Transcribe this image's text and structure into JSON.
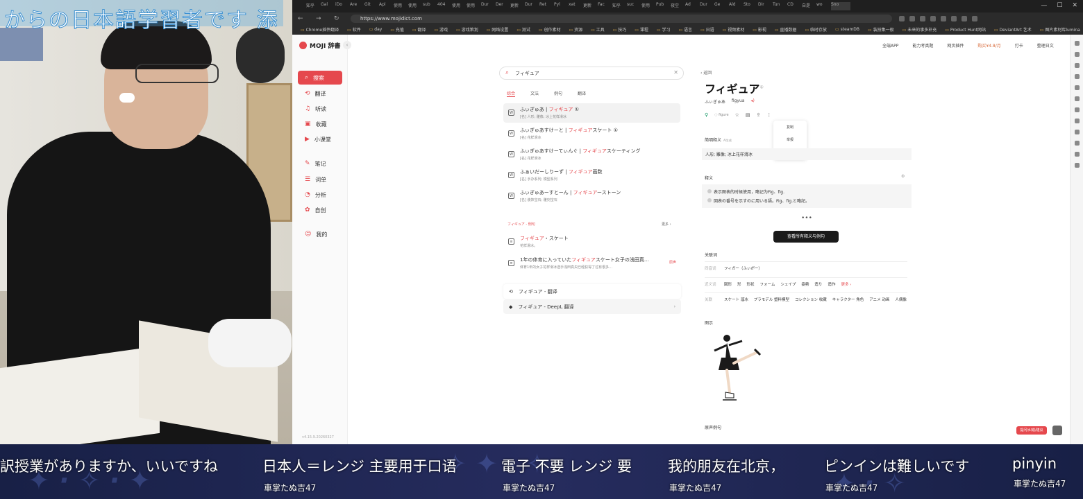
{
  "overlay": {
    "top_caption": "からの日本語学習者です 添"
  },
  "browser": {
    "url": "https://www.mojidict.com",
    "tabs": [
      "知乎",
      "Gal",
      "iDo",
      "Are",
      "Git",
      "Apl",
      "使用",
      "使用",
      "sub",
      "404",
      "使用",
      "使用",
      "Dur",
      "Der",
      "更新",
      "Dur",
      "Ret",
      "Pyl",
      "xat",
      "更新",
      "Fac",
      "知乎",
      "suc",
      "使用",
      "Pub",
      "夜空",
      "Ad",
      "Dur",
      "Ge",
      "Ald",
      "Sto",
      "Dir",
      "Tun",
      "CD",
      "自是",
      "wo",
      "Sno"
    ],
    "bookmarks": [
      "Chrome插件翻译",
      "软件",
      "day",
      "充值",
      "翻译",
      "游戏",
      "游戏策划",
      "网络设置",
      "测试",
      "创作素材",
      "资源",
      "工具",
      "技巧",
      "课程",
      "学习",
      "语言",
      "日语",
      "视频素材",
      "影视",
      "直播数据",
      "临时存放",
      "steamDB",
      "装扮集一般",
      "未来的事多补充",
      "Product Hunt网站",
      "DeviantArt 艺术",
      "图片素材库lumina"
    ]
  },
  "app": {
    "logo": "MOJI 辞書",
    "nav": [
      {
        "label": "搜索",
        "icon": "magnify-icon"
      },
      {
        "label": "翻译",
        "icon": "translate-icon"
      },
      {
        "label": "听读",
        "icon": "headphones-icon"
      },
      {
        "label": "收藏",
        "icon": "folder-icon"
      },
      {
        "label": "小课堂",
        "icon": "play-icon"
      },
      {
        "label": "笔记",
        "icon": "note-icon"
      },
      {
        "label": "词单",
        "icon": "list-icon"
      },
      {
        "label": "分析",
        "icon": "analyze-icon"
      },
      {
        "label": "自创",
        "icon": "bulb-icon"
      },
      {
        "label": "我的",
        "icon": "user-icon"
      }
    ],
    "version": "v4.15.9.20260327",
    "header": [
      "全端APP",
      "能力考真题",
      "网页插件",
      "购买¥4.8/月",
      "打卡",
      "整理日文"
    ],
    "search": {
      "value": "フィギュア",
      "tabs": [
        "综合",
        "文法",
        "例句",
        "翻译"
      ]
    },
    "results": [
      {
        "kana": "ふぃぎゅあ",
        "word": "フィギュア",
        "tail": " ①",
        "meaning": "[名] 人形; 雕像; 冰上花样滑冰"
      },
      {
        "kana": "ふぃぎゅあすけーと",
        "word": "フィギュア",
        "tail": "スケート ①",
        "meaning": "[名] 花样滑冰"
      },
      {
        "kana": "ふぃぎゅあすけーてぃんぐ",
        "word": "フィギュア",
        "tail": "スケーティング",
        "meaning": "[名] 花样滑冰"
      },
      {
        "kana": "ふぁいだーしりーず",
        "word": "フィギュア",
        "tail": "画数",
        "meaning": "[名] 手办系列; 模型系列"
      },
      {
        "kana": "ふぃぎゅあーすとーん",
        "word": "フィギュア",
        "tail": "ーストーン",
        "meaning": "[名] 装饰宝石; 雕刻宝石"
      }
    ],
    "examples_head": "フィギュア - 例句",
    "examples_more": "更多 ›",
    "examples": [
      {
        "pre": "",
        "word": "フィギュア",
        "tail": "・スケート",
        "meaning": "花样滑冰。"
      },
      {
        "pre": "1年の体育に入っていた",
        "word": "フィギュア",
        "tail": "スケート女子の浅田真…",
        "meaning": "体育1年的女子花样滑冰选手浅田真央已经获得了过有很多…"
      }
    ],
    "example_badge": "原声",
    "cards": [
      {
        "label": "フィギュア - 翻译"
      },
      {
        "label": "フィギュア - DeepL 翻译"
      }
    ],
    "detail": {
      "back": "‹ 返回",
      "word": "フィギュア",
      "accent": "①",
      "kana": "ふぃぎゅあ",
      "roman": "figyua",
      "origin": "figure",
      "menu": [
        "复制",
        "举报",
        "设置"
      ],
      "brief_title": "简明释义",
      "brief_tag": "AI生成",
      "brief_text": "人形; 雕像; 冰上花样滑冰",
      "def_title": "释义",
      "defs": [
        "表示图表的时候使用，略记为Fig、fig.",
        "図表の番号を示すのに用いる語。Fig、fig.と略記。"
      ],
      "all_button": "查看所有释义与例句",
      "rel_title": "关联词",
      "rel_rows": [
        {
          "label": "同音词",
          "items": [
            "フィガー（ふぃがー）"
          ]
        },
        {
          "label": "近义词",
          "items": [
            "図形",
            "形",
            "形状",
            "フォーム",
            "シェイプ",
            "姿勢",
            "造り",
            "造作"
          ],
          "more": "更多 ›"
        },
        {
          "label": "关联",
          "items": [
            "スケート 溜冰",
            "プラモデル 塑料模型",
            "コレクション 收藏",
            "キャラクター 角色",
            "アニメ 动画",
            "人偶像"
          ]
        }
      ],
      "illus_title": "图示",
      "orig_title": "原声例句",
      "red_button": "提问/纠错/建议"
    }
  },
  "subtitles": [
    {
      "text": "訳授業がありますか、いいですね",
      "user": ""
    },
    {
      "text": "日本人＝レンジ 主要用于口语",
      "user": "車掌たぬ吉47"
    },
    {
      "text": "電子 不要 レンジ 要",
      "user": "車掌たぬ吉47"
    },
    {
      "text": "我的朋友在北京，",
      "user": "車掌たぬ吉47"
    },
    {
      "text": "ピンインは難しいです",
      "user": "車掌たぬ吉47"
    },
    {
      "text": "pinyin",
      "user": "車掌たぬ吉47"
    }
  ],
  "colors": {
    "accent": "#e5484d",
    "subtitle_bg": "#1e2550"
  }
}
